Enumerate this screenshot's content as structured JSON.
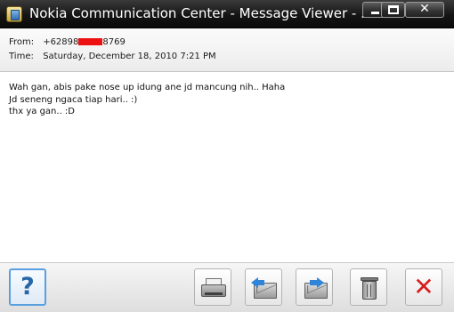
{
  "window": {
    "title": "Nokia Communication Center - Message Viewer - ...",
    "controls": {
      "minimize_icon": "minimize-icon",
      "maximize_icon": "maximize-icon",
      "close_glyph": "✕"
    }
  },
  "header": {
    "from_label": "From:",
    "from_prefix": "+62898",
    "from_suffix": "8769",
    "time_label": "Time:",
    "time_value": "Saturday, December 18, 2010 7:21 PM"
  },
  "message": {
    "body": "Wah gan, abis pake nose up idung ane jd mancung nih.. Haha\nJd seneng ngaca tiap hari.. :)\nthx ya gan.. :D"
  },
  "toolbar": {
    "help_glyph": "?",
    "close_glyph": "✕",
    "icons": [
      "help-icon",
      "print-icon",
      "reply-icon",
      "forward-icon",
      "trash-icon",
      "close-icon"
    ]
  },
  "colors": {
    "titlebar": "#151515",
    "redaction": "#ee1111",
    "help_accent": "#2766a8",
    "close_red": "#d71f1f"
  }
}
